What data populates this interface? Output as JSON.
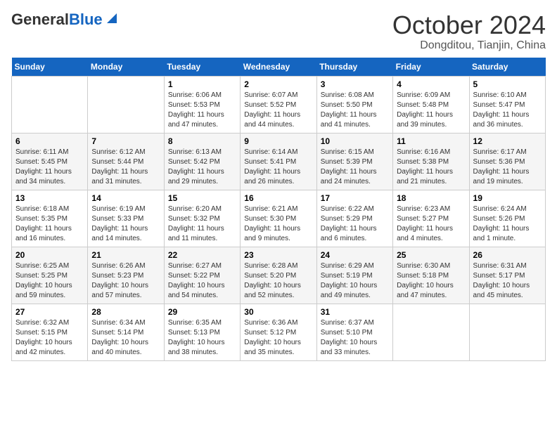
{
  "header": {
    "logo_line1": "General",
    "logo_line2": "Blue",
    "month_year": "October 2024",
    "location": "Dongditou, Tianjin, China"
  },
  "days_of_week": [
    "Sunday",
    "Monday",
    "Tuesday",
    "Wednesday",
    "Thursday",
    "Friday",
    "Saturday"
  ],
  "weeks": [
    [
      {
        "day": "",
        "sunrise": "",
        "sunset": "",
        "daylight": ""
      },
      {
        "day": "",
        "sunrise": "",
        "sunset": "",
        "daylight": ""
      },
      {
        "day": "1",
        "sunrise": "Sunrise: 6:06 AM",
        "sunset": "Sunset: 5:53 PM",
        "daylight": "Daylight: 11 hours and 47 minutes."
      },
      {
        "day": "2",
        "sunrise": "Sunrise: 6:07 AM",
        "sunset": "Sunset: 5:52 PM",
        "daylight": "Daylight: 11 hours and 44 minutes."
      },
      {
        "day": "3",
        "sunrise": "Sunrise: 6:08 AM",
        "sunset": "Sunset: 5:50 PM",
        "daylight": "Daylight: 11 hours and 41 minutes."
      },
      {
        "day": "4",
        "sunrise": "Sunrise: 6:09 AM",
        "sunset": "Sunset: 5:48 PM",
        "daylight": "Daylight: 11 hours and 39 minutes."
      },
      {
        "day": "5",
        "sunrise": "Sunrise: 6:10 AM",
        "sunset": "Sunset: 5:47 PM",
        "daylight": "Daylight: 11 hours and 36 minutes."
      }
    ],
    [
      {
        "day": "6",
        "sunrise": "Sunrise: 6:11 AM",
        "sunset": "Sunset: 5:45 PM",
        "daylight": "Daylight: 11 hours and 34 minutes."
      },
      {
        "day": "7",
        "sunrise": "Sunrise: 6:12 AM",
        "sunset": "Sunset: 5:44 PM",
        "daylight": "Daylight: 11 hours and 31 minutes."
      },
      {
        "day": "8",
        "sunrise": "Sunrise: 6:13 AM",
        "sunset": "Sunset: 5:42 PM",
        "daylight": "Daylight: 11 hours and 29 minutes."
      },
      {
        "day": "9",
        "sunrise": "Sunrise: 6:14 AM",
        "sunset": "Sunset: 5:41 PM",
        "daylight": "Daylight: 11 hours and 26 minutes."
      },
      {
        "day": "10",
        "sunrise": "Sunrise: 6:15 AM",
        "sunset": "Sunset: 5:39 PM",
        "daylight": "Daylight: 11 hours and 24 minutes."
      },
      {
        "day": "11",
        "sunrise": "Sunrise: 6:16 AM",
        "sunset": "Sunset: 5:38 PM",
        "daylight": "Daylight: 11 hours and 21 minutes."
      },
      {
        "day": "12",
        "sunrise": "Sunrise: 6:17 AM",
        "sunset": "Sunset: 5:36 PM",
        "daylight": "Daylight: 11 hours and 19 minutes."
      }
    ],
    [
      {
        "day": "13",
        "sunrise": "Sunrise: 6:18 AM",
        "sunset": "Sunset: 5:35 PM",
        "daylight": "Daylight: 11 hours and 16 minutes."
      },
      {
        "day": "14",
        "sunrise": "Sunrise: 6:19 AM",
        "sunset": "Sunset: 5:33 PM",
        "daylight": "Daylight: 11 hours and 14 minutes."
      },
      {
        "day": "15",
        "sunrise": "Sunrise: 6:20 AM",
        "sunset": "Sunset: 5:32 PM",
        "daylight": "Daylight: 11 hours and 11 minutes."
      },
      {
        "day": "16",
        "sunrise": "Sunrise: 6:21 AM",
        "sunset": "Sunset: 5:30 PM",
        "daylight": "Daylight: 11 hours and 9 minutes."
      },
      {
        "day": "17",
        "sunrise": "Sunrise: 6:22 AM",
        "sunset": "Sunset: 5:29 PM",
        "daylight": "Daylight: 11 hours and 6 minutes."
      },
      {
        "day": "18",
        "sunrise": "Sunrise: 6:23 AM",
        "sunset": "Sunset: 5:27 PM",
        "daylight": "Daylight: 11 hours and 4 minutes."
      },
      {
        "day": "19",
        "sunrise": "Sunrise: 6:24 AM",
        "sunset": "Sunset: 5:26 PM",
        "daylight": "Daylight: 11 hours and 1 minute."
      }
    ],
    [
      {
        "day": "20",
        "sunrise": "Sunrise: 6:25 AM",
        "sunset": "Sunset: 5:25 PM",
        "daylight": "Daylight: 10 hours and 59 minutes."
      },
      {
        "day": "21",
        "sunrise": "Sunrise: 6:26 AM",
        "sunset": "Sunset: 5:23 PM",
        "daylight": "Daylight: 10 hours and 57 minutes."
      },
      {
        "day": "22",
        "sunrise": "Sunrise: 6:27 AM",
        "sunset": "Sunset: 5:22 PM",
        "daylight": "Daylight: 10 hours and 54 minutes."
      },
      {
        "day": "23",
        "sunrise": "Sunrise: 6:28 AM",
        "sunset": "Sunset: 5:20 PM",
        "daylight": "Daylight: 10 hours and 52 minutes."
      },
      {
        "day": "24",
        "sunrise": "Sunrise: 6:29 AM",
        "sunset": "Sunset: 5:19 PM",
        "daylight": "Daylight: 10 hours and 49 minutes."
      },
      {
        "day": "25",
        "sunrise": "Sunrise: 6:30 AM",
        "sunset": "Sunset: 5:18 PM",
        "daylight": "Daylight: 10 hours and 47 minutes."
      },
      {
        "day": "26",
        "sunrise": "Sunrise: 6:31 AM",
        "sunset": "Sunset: 5:17 PM",
        "daylight": "Daylight: 10 hours and 45 minutes."
      }
    ],
    [
      {
        "day": "27",
        "sunrise": "Sunrise: 6:32 AM",
        "sunset": "Sunset: 5:15 PM",
        "daylight": "Daylight: 10 hours and 42 minutes."
      },
      {
        "day": "28",
        "sunrise": "Sunrise: 6:34 AM",
        "sunset": "Sunset: 5:14 PM",
        "daylight": "Daylight: 10 hours and 40 minutes."
      },
      {
        "day": "29",
        "sunrise": "Sunrise: 6:35 AM",
        "sunset": "Sunset: 5:13 PM",
        "daylight": "Daylight: 10 hours and 38 minutes."
      },
      {
        "day": "30",
        "sunrise": "Sunrise: 6:36 AM",
        "sunset": "Sunset: 5:12 PM",
        "daylight": "Daylight: 10 hours and 35 minutes."
      },
      {
        "day": "31",
        "sunrise": "Sunrise: 6:37 AM",
        "sunset": "Sunset: 5:10 PM",
        "daylight": "Daylight: 10 hours and 33 minutes."
      },
      {
        "day": "",
        "sunrise": "",
        "sunset": "",
        "daylight": ""
      },
      {
        "day": "",
        "sunrise": "",
        "sunset": "",
        "daylight": ""
      }
    ]
  ]
}
